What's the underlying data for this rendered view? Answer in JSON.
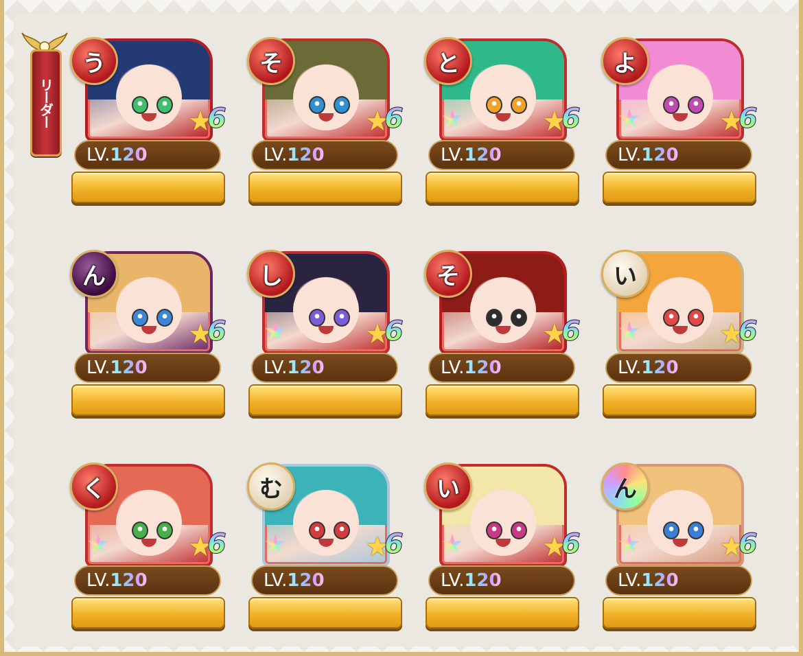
{
  "leader": {
    "label": "リーダー"
  },
  "level_prefix": "LV.",
  "rows": [
    [
      {
        "kana": "う",
        "element": "fire",
        "level": "120",
        "rank": "6",
        "hair": "#233a74",
        "eye": "#3fbf6a",
        "frame": "#b51c21"
      },
      {
        "kana": "そ",
        "element": "fire",
        "level": "120",
        "rank": "6",
        "hair": "#6a6b36",
        "eye": "#2f8fd0",
        "frame": "#c02b2c"
      },
      {
        "kana": "と",
        "element": "fire",
        "level": "120",
        "rank": "6",
        "hair": "#2fb889",
        "eye": "#f0a12a",
        "frame": "#c02b2c"
      },
      {
        "kana": "よ",
        "element": "fire",
        "level": "120",
        "rank": "6",
        "hair": "#f28ad4",
        "eye": "#c04bb0",
        "frame": "#c02b2c"
      }
    ],
    [
      {
        "kana": "ん",
        "element": "dark",
        "level": "120",
        "rank": "6",
        "hair": "#e8b56a",
        "eye": "#3b86d6",
        "frame": "#6b2563"
      },
      {
        "kana": "し",
        "element": "fire",
        "level": "120",
        "rank": "6",
        "hair": "#2a2440",
        "eye": "#7a5cd6",
        "frame": "#c02b2c"
      },
      {
        "kana": "そ",
        "element": "fire",
        "level": "120",
        "rank": "6",
        "hair": "#8e1c16",
        "eye": "#2d2d2d",
        "frame": "#b31b1f"
      },
      {
        "kana": "い",
        "element": "light",
        "level": "120",
        "rank": "6",
        "hair": "#f4a53b",
        "eye": "#e04747",
        "frame": "#c9b48b"
      }
    ],
    [
      {
        "kana": "く",
        "element": "fire",
        "level": "120",
        "rank": "6",
        "hair": "#e56a55",
        "eye": "#47b04b",
        "frame": "#c02b2c"
      },
      {
        "kana": "む",
        "element": "light",
        "level": "120",
        "rank": "6",
        "hair": "#3bb3b8",
        "eye": "#d13c3c",
        "frame": "#a9c8d8"
      },
      {
        "kana": "い",
        "element": "fire",
        "level": "120",
        "rank": "6",
        "hair": "#f2e6a8",
        "eye": "#c83a86",
        "frame": "#c02b2c"
      },
      {
        "kana": "ん",
        "element": "multi",
        "level": "120",
        "rank": "6",
        "hair": "#f0c17b",
        "eye": "#3a7fd6",
        "frame": "#d59a7a"
      }
    ]
  ]
}
